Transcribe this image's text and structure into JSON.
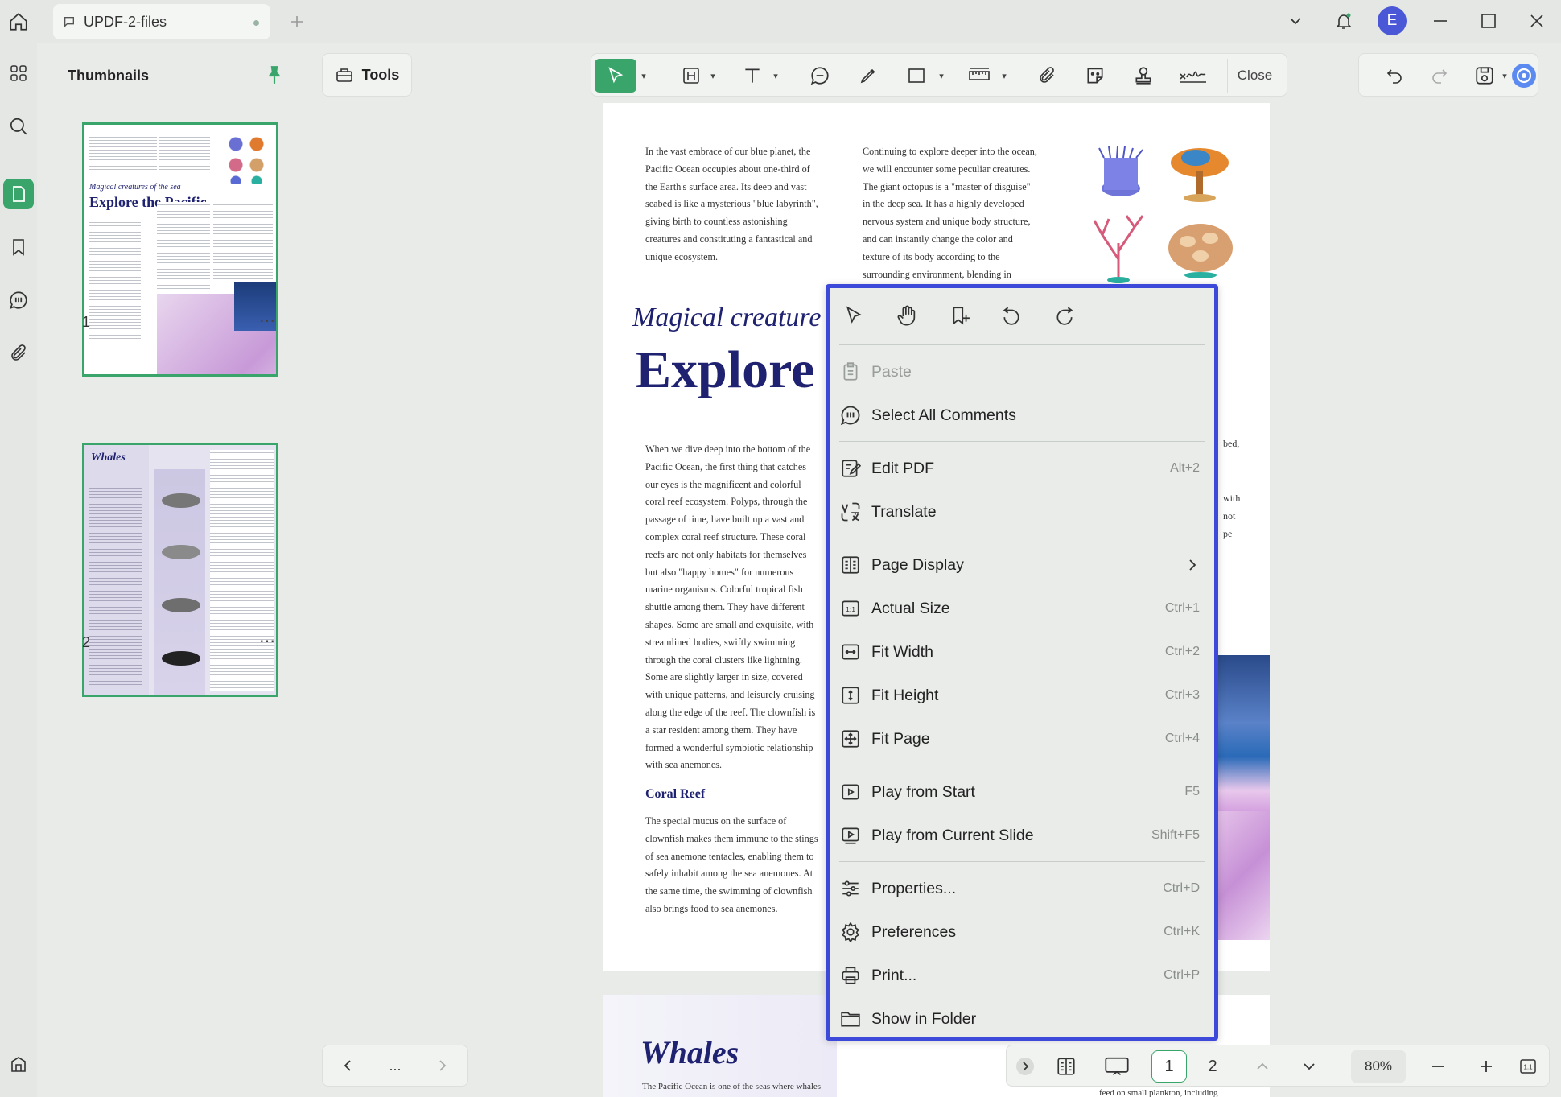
{
  "window": {
    "tab_title": "UPDF-2-files",
    "avatar_letter": "E"
  },
  "thumbnails": {
    "title": "Thumbnails",
    "pages": [
      {
        "number": "1",
        "heading_italic": "Magical creatures of the sea",
        "heading": "Explore the Pacific"
      },
      {
        "number": "2",
        "heading_italic": "Whales"
      }
    ]
  },
  "toolbar": {
    "tools_label": "Tools",
    "close_label": "Close"
  },
  "page": {
    "col1_text": "In the vast embrace of our blue planet, the Pacific Ocean occupies about one-third of the Earth's surface area. Its deep and vast seabed is like a mysterious \"blue labyrinth\", giving birth to countless astonishing creatures and constituting a fantastical and unique ecosystem.",
    "col2_text": "Continuing to explore deeper into the ocean, we will encounter some peculiar creatures. The giant octopus is a \"master of disguise\" in the deep sea. It has a highly developed nervous system and unique body structure, and can instantly change the color and texture of its body according to the surrounding environment, blending in",
    "heading_italic": "Magical creature",
    "heading_big": "Explore",
    "body_text": "When we dive deep into the bottom of the Pacific Ocean, the first thing that catches our eyes is the magnificent and colorful coral reef ecosystem. Polyps, through the passage of time, have built up a vast and complex coral reef structure. These coral reefs are not only habitats for themselves but also \"happy homes\" for numerous marine organisms. Colorful tropical fish shuttle among them. They have different shapes. Some are small and exquisite, with streamlined bodies, swiftly swimming through the coral clusters like lightning. Some are slightly larger in size, covered with unique patterns, and leisurely cruising along the edge of the reef. The clownfish is a star resident among them. They have formed a wonderful symbiotic relationship with sea anemones.",
    "coral_heading": "Coral Reef",
    "coral_text": "The special mucus on the surface of clownfish makes them immune to the stings of sea anemone tentacles, enabling them to safely inhabit among the sea anemones. At the same time, the swimming of clownfish also brings food to sea anemones.",
    "frag1": "bed,",
    "frag2": "with",
    "frag3": "not",
    "frag4": "pe",
    "page2_heading": "Whales",
    "page2_text": "The Pacific Ocean is one of the seas where whales",
    "page2_frag": "feed on small plankton, including"
  },
  "context_menu": {
    "items": [
      {
        "label": "Paste",
        "shortcut": "",
        "disabled": true
      },
      {
        "label": "Select All Comments",
        "shortcut": ""
      },
      {
        "label": "Edit PDF",
        "shortcut": "Alt+2"
      },
      {
        "label": "Translate",
        "shortcut": ""
      },
      {
        "label": "Page Display",
        "shortcut": ""
      },
      {
        "label": "Actual Size",
        "shortcut": "Ctrl+1"
      },
      {
        "label": "Fit Width",
        "shortcut": "Ctrl+2"
      },
      {
        "label": "Fit Height",
        "shortcut": "Ctrl+3"
      },
      {
        "label": "Fit Page",
        "shortcut": "Ctrl+4"
      },
      {
        "label": "Play from Start",
        "shortcut": "F5"
      },
      {
        "label": "Play from Current Slide",
        "shortcut": "Shift+F5"
      },
      {
        "label": "Properties...",
        "shortcut": "Ctrl+D"
      },
      {
        "label": "Preferences",
        "shortcut": "Ctrl+K"
      },
      {
        "label": "Print...",
        "shortcut": "Ctrl+P"
      },
      {
        "label": "Show in Folder",
        "shortcut": ""
      }
    ]
  },
  "bottom_bar": {
    "nav_more": "...",
    "page_current": "1",
    "page_other": "2",
    "zoom": "80%"
  },
  "colors": {
    "accent_green": "#3aa56b",
    "menu_border": "#3d49d8",
    "heading_navy": "#1f2270",
    "avatar_blue": "#4a57d6"
  }
}
